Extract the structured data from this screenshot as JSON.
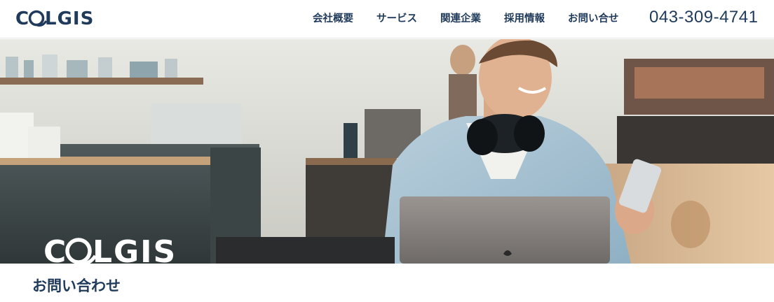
{
  "brand": {
    "name": "COLGIS",
    "color": "#1f3a5a"
  },
  "nav": {
    "items": [
      {
        "label": "会社概要"
      },
      {
        "label": "サービス"
      },
      {
        "label": "関連企業"
      },
      {
        "label": "採用情報"
      },
      {
        "label": "お問い合せ"
      }
    ],
    "phone": "043-309-4741"
  },
  "hero": {
    "logo_text": "COLGIS",
    "image_description_icon": "photo-cafe-man-laptop"
  },
  "page": {
    "section_title": "お問い合わせ"
  }
}
